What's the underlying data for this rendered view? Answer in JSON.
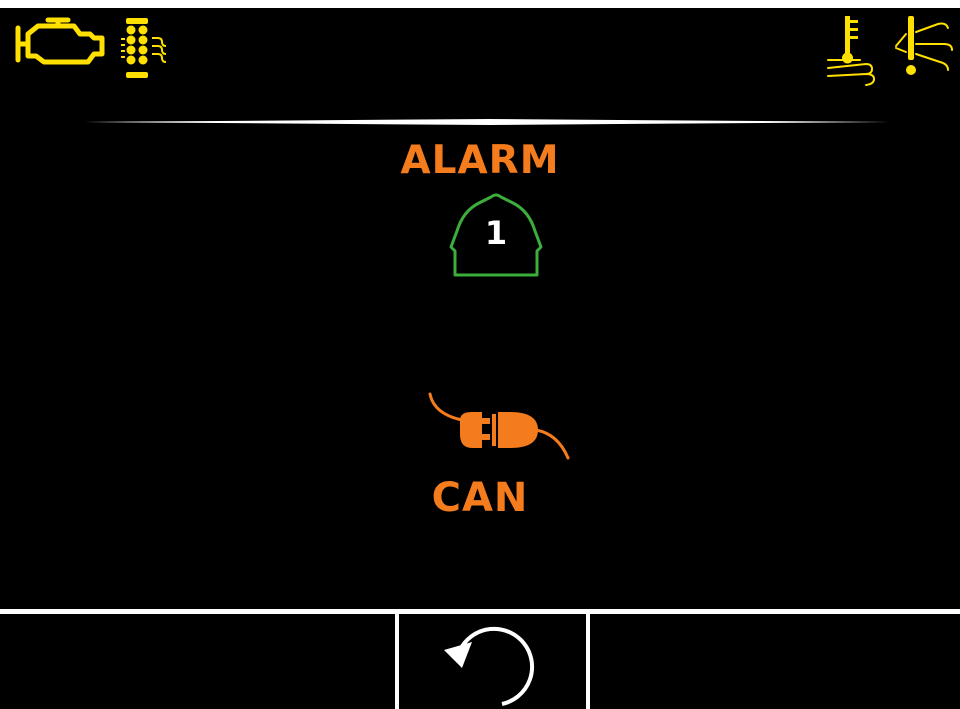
{
  "colors": {
    "accent": "#f57c1c",
    "warning": "#ffe000",
    "ok": "#3cae3c",
    "frame": "#ffffff",
    "background": "#000000"
  },
  "status_icons": {
    "left": [
      "engine-check-icon",
      "particulate-filter-icon"
    ],
    "right": [
      "exhaust-temperature-icon",
      "exhaust-warning-icon"
    ]
  },
  "alarm": {
    "title": "ALARM",
    "number": "1"
  },
  "fault": {
    "icon": "can-connector-icon",
    "label": "CAN"
  },
  "softkeys": [
    {
      "position": "left",
      "label": ""
    },
    {
      "position": "center",
      "icon": "back-arrow-icon"
    },
    {
      "position": "right",
      "label": ""
    }
  ]
}
